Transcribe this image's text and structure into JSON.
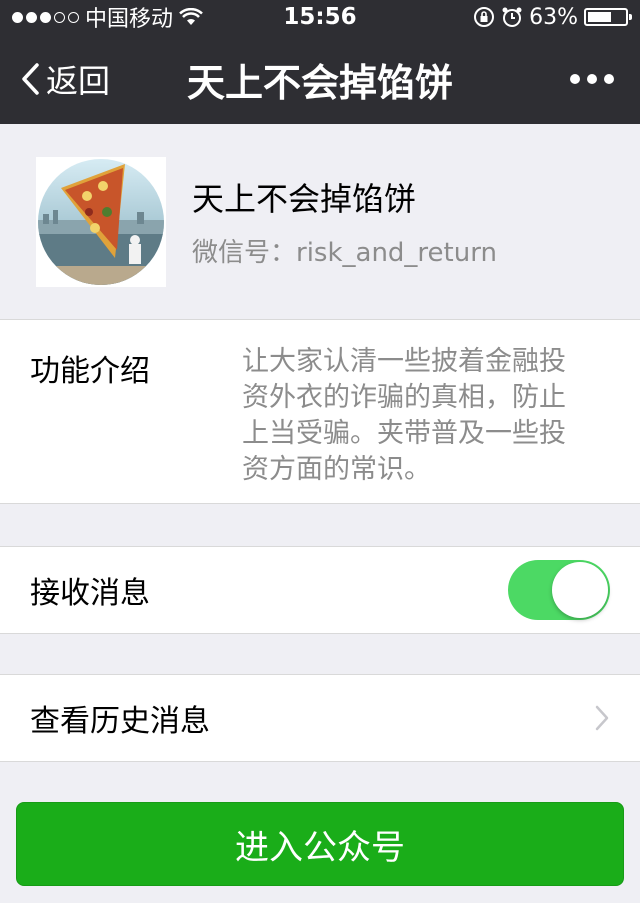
{
  "status_bar": {
    "carrier": "中国移动",
    "time": "15:56",
    "battery_percent": "63%",
    "battery_level": 0.63
  },
  "nav": {
    "back_label": "返回",
    "title": "天上不会掉馅饼"
  },
  "profile": {
    "name": "天上不会掉馅饼",
    "wechat_id": "微信号：risk_and_return"
  },
  "intro": {
    "label": "功能介绍",
    "text": "让大家认清一些披着金融投资外衣的诈骗的真相，防止上当受骗。夹带普及一些投资方面的常识。"
  },
  "receive_messages": {
    "label": "接收消息",
    "enabled": true
  },
  "history": {
    "label": "查看历史消息"
  },
  "enter_button": {
    "label": "进入公众号"
  },
  "colors": {
    "nav_bg": "#2e2e33",
    "toggle_on": "#4cd964",
    "primary_button": "#1aad19"
  }
}
